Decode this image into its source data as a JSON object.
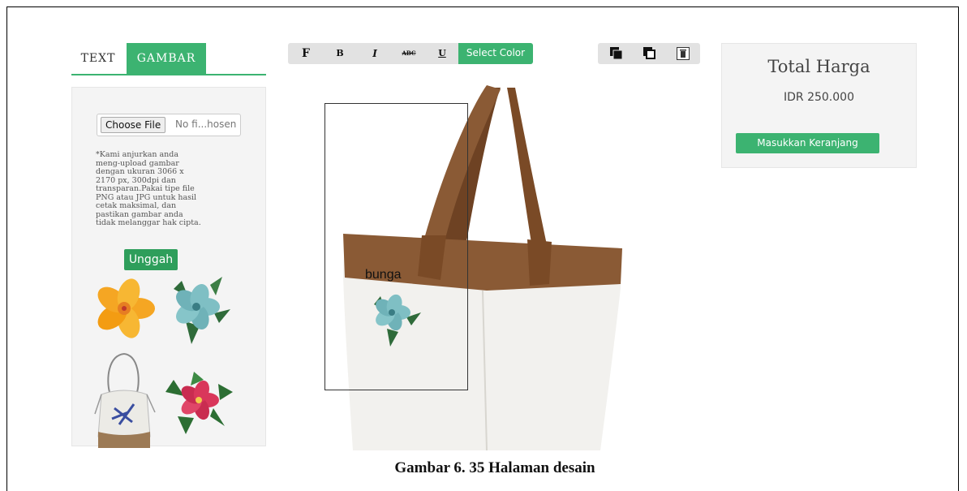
{
  "tabs": [
    {
      "label": "TEXT"
    },
    {
      "label": "GAMBAR"
    }
  ],
  "left_panel": {
    "file_button": "Choose File",
    "file_status": "No fi...hosen",
    "note": "*Kami anjurkan anda\nmeng-upload gambar\ndengan ukuran 3066 x\n2170 px, 300dpi dan\ntransparan.Pakai tipe file\nPNG atau JPG untuk hasil\ncetak maksimal, dan\npastikan gambar anda\ntidak melanggar hak cipta.",
    "upload_button": "Unggah",
    "thumbnails": [
      "yellow-hibiscus",
      "blue-hibiscus",
      "drawstring-bag",
      "red-flowers"
    ]
  },
  "toolbar": {
    "font_label": "F",
    "bold_label": "B",
    "italic_label": "I",
    "strike_label": "ABC",
    "underline_label": "U",
    "select_color_label": "Select Color",
    "icons": [
      "bring-front-icon",
      "send-back-icon",
      "delete-icon"
    ]
  },
  "price_panel": {
    "title": "Total Harga",
    "value": "IDR 250.000",
    "cart_button": "Masukkan Keranjang"
  },
  "canvas": {
    "label_text": "bunga",
    "colors": {
      "handle": "#7a4a26",
      "bag": "#f2f1ee",
      "trim": "#8a5a35"
    }
  },
  "caption": "Gambar 6.  35 Halaman desain"
}
